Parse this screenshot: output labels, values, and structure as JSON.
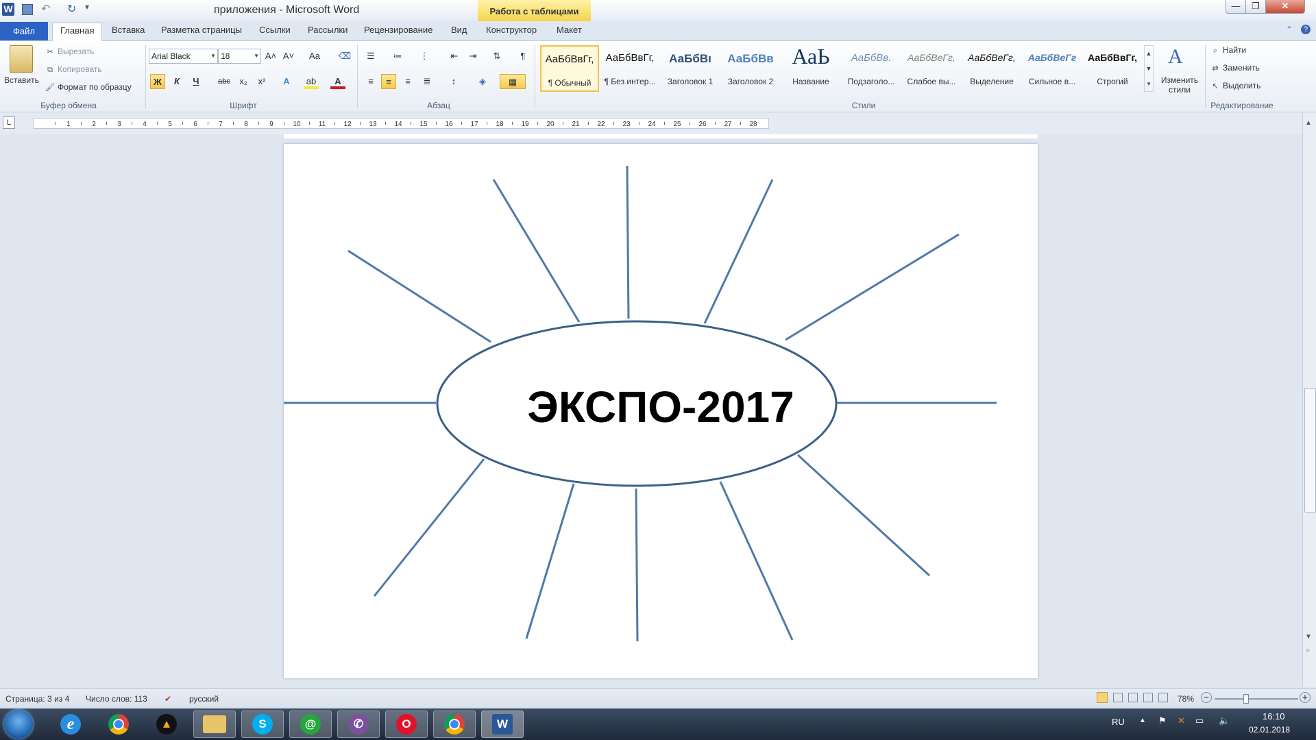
{
  "window": {
    "title": "приложения - Microsoft Word",
    "context_header": "Работа с таблицами",
    "buttons": {
      "minimize": "—",
      "maximize": "❐",
      "close": "✕"
    }
  },
  "quick_access": {
    "undo": "↶",
    "redo": "↻",
    "customize": "▾"
  },
  "tabs": {
    "file": "Файл",
    "items": [
      "Главная",
      "Вставка",
      "Разметка страницы",
      "Ссылки",
      "Рассылки",
      "Рецензирование",
      "Вид",
      "Конструктор",
      "Макет"
    ]
  },
  "ribbon": {
    "clipboard": {
      "paste": "Вставить",
      "cut": "Вырезать",
      "copy": "Копировать",
      "format_painter": "Формат по образцу",
      "label": "Буфер обмена"
    },
    "font": {
      "name": "Arial Black",
      "size": "18",
      "grow": "A˄",
      "shrink": "A˅",
      "case": "Aa",
      "bold": "Ж",
      "italic": "К",
      "underline": "Ч",
      "strike": "abc",
      "subscript": "x₂",
      "superscript": "x²",
      "label": "Шрифт"
    },
    "paragraph": {
      "label": "Абзац",
      "pilcrow": "¶"
    },
    "styles": {
      "label": "Стили",
      "items": [
        {
          "sample": "АаБбВвГг,",
          "name": "¶ Обычный"
        },
        {
          "sample": "АаБбВвГг,",
          "name": "¶ Без интер..."
        },
        {
          "sample": "АаБбВı",
          "name": "Заголовок 1"
        },
        {
          "sample": "АаБбВв",
          "name": "Заголовок 2"
        },
        {
          "sample": "АаЬ",
          "name": "Название"
        },
        {
          "sample": "АаБбВв.",
          "name": "Подзаголо..."
        },
        {
          "sample": "АаБбВеГг,",
          "name": "Слабое вы..."
        },
        {
          "sample": "АаБбВеГг,",
          "name": "Выделение"
        },
        {
          "sample": "АаБбВеГг",
          "name": "Сильное в..."
        },
        {
          "sample": "АаБбВвГг,",
          "name": "Строгий"
        }
      ],
      "change_styles": "Изменить стили"
    },
    "editing": {
      "find": "Найти",
      "replace": "Заменить",
      "select": "Выделить",
      "label": "Редактирование"
    }
  },
  "ruler": {
    "ticks": [
      "1",
      "2",
      "3",
      "4",
      "5",
      "6",
      "7",
      "8",
      "9",
      "10",
      "11",
      "12",
      "13",
      "14",
      "15",
      "16",
      "17",
      "18",
      "19",
      "20",
      "21",
      "22",
      "23",
      "24",
      "25",
      "26",
      "27",
      "28"
    ]
  },
  "document": {
    "diagram_text": "ЭКСПО-2017",
    "colors": {
      "ray": "#4f79a8",
      "ellipse": "#3c5f86",
      "text": "#000000"
    }
  },
  "status": {
    "page": "Страница: 3 из 4",
    "words": "Число слов: 113",
    "language": "русский",
    "zoom": "78%",
    "zoom_level": 0.78
  },
  "taskbar": {
    "apps": [
      "internet-explorer",
      "chrome",
      "archicad",
      "file-explorer",
      "skype",
      "agent-mail",
      "viber",
      "opera",
      "chrome",
      "word"
    ],
    "tray": {
      "lang": "RU",
      "time": "16:10",
      "date": "02.01.2018"
    }
  }
}
